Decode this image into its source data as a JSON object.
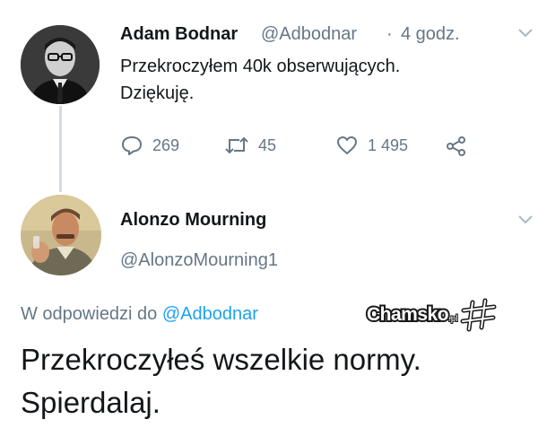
{
  "tweet1": {
    "author_name": "Adam Bodnar",
    "author_handle": "@Adbodnar",
    "separator": "·",
    "time": "4 godz.",
    "text_line1": "Przekroczyłem 40k obserwujących.",
    "text_line2": "Dziękuję.",
    "replies": "269",
    "retweets": "45",
    "likes": "1 495"
  },
  "tweet2": {
    "author_name": "Alonzo Mourning",
    "author_handle": "@AlonzoMourning1",
    "reply_prefix": "W odpowiedzi do",
    "reply_target": "@Adbodnar",
    "text_line1": "Przekroczyłeś wszelkie normy.",
    "text_line2": "Spierdalaj."
  },
  "watermark": {
    "brand": "Chamsko",
    "tld": ".pl"
  },
  "colors": {
    "link": "#1da1f2",
    "secondary": "#657786",
    "thread_line": "#d4dbe1"
  }
}
